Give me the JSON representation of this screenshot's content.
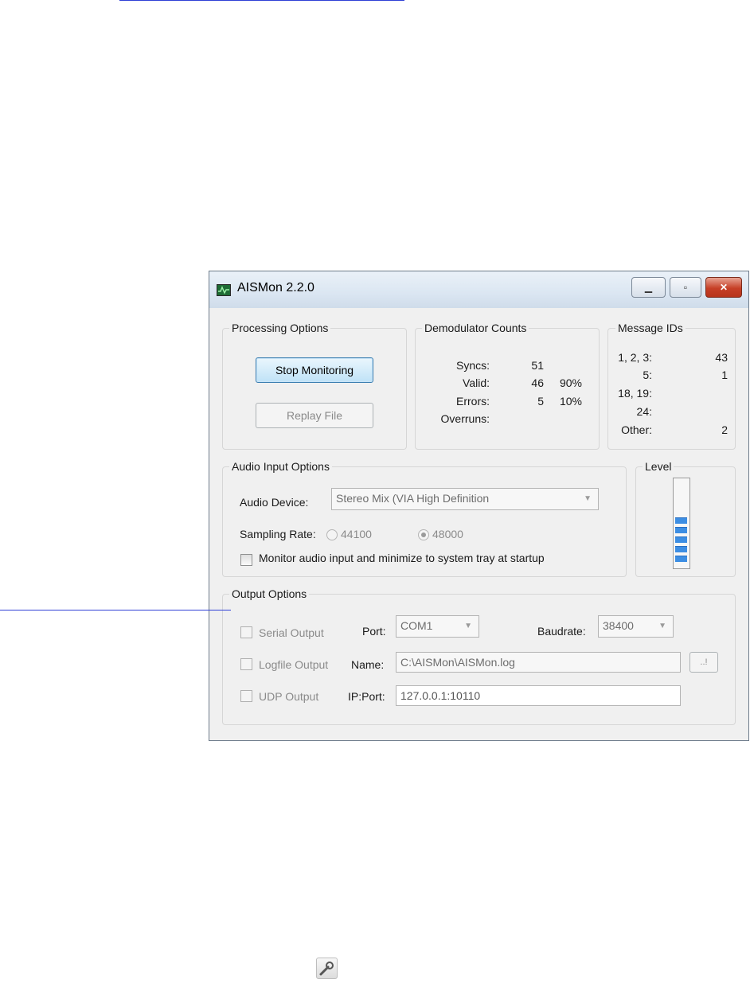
{
  "window": {
    "title": "AISMon 2.2.0",
    "minimize": "▁",
    "maximize": "▫",
    "close": "✕"
  },
  "processing": {
    "group_label": "Processing Options",
    "stop_label": "Stop Monitoring",
    "replay_label": "Replay File"
  },
  "demod": {
    "group_label": "Demodulator Counts",
    "rows": [
      {
        "label": "Syncs:",
        "count": "51",
        "pct": ""
      },
      {
        "label": "Valid:",
        "count": "46",
        "pct": "90%"
      },
      {
        "label": "Errors:",
        "count": "5",
        "pct": "10%"
      },
      {
        "label": "Overruns:",
        "count": "",
        "pct": ""
      }
    ]
  },
  "msgids": {
    "group_label": "Message IDs",
    "rows": [
      {
        "label": "1, 2, 3:",
        "value": "43"
      },
      {
        "label": "5:",
        "value": "1"
      },
      {
        "label": "18, 19:",
        "value": ""
      },
      {
        "label": "24:",
        "value": ""
      },
      {
        "label": "Other:",
        "value": "2"
      }
    ]
  },
  "audio": {
    "group_label": "Audio Input Options",
    "device_label": "Audio Device:",
    "device_value": "Stereo Mix (VIA High Definition",
    "rate_label": "Sampling Rate:",
    "rate_44100": "44100",
    "rate_48000": "48000",
    "selected_rate": "48000",
    "monitor_label": "Monitor audio input and minimize to system tray at startup",
    "monitor_checked": false
  },
  "level": {
    "label": "Level",
    "active_segments": 5
  },
  "output": {
    "group_label": "Output Options",
    "serial_label": "Serial Output",
    "port_label": "Port:",
    "port_value": "COM1",
    "baud_label": "Baudrate:",
    "baud_value": "38400",
    "logfile_label": "Logfile Output",
    "name_label": "Name:",
    "name_value": "C:\\AISMon\\AISMon.log",
    "browse_label": "..!",
    "udp_label": "UDP Output",
    "ipport_label": "IP:Port:",
    "ipport_value": "127.0.0.1:10110"
  },
  "colors": {
    "level_bar": "#3d8ee3",
    "close_button": "#c64027",
    "link_underline": "#2f3fd6"
  },
  "icons": {
    "app": "oscilloscope-icon",
    "tool": "wrench-icon"
  }
}
